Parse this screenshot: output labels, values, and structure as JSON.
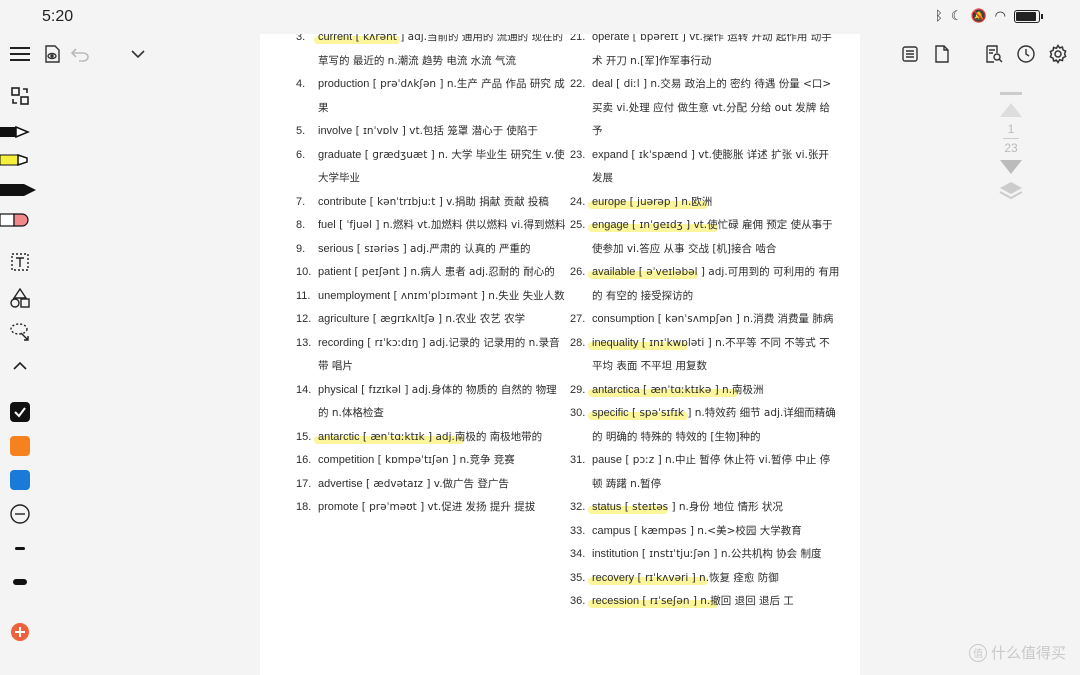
{
  "status": {
    "time": "5:20"
  },
  "palette": {
    "highlight": "#f7ee5a",
    "orange": "#f5811f",
    "blue": "#1a7ad8",
    "red": "#f0603c",
    "black": "#111111"
  },
  "icons": {
    "left_toolbar": [
      "menu-icon",
      "swap-icon",
      "pen-icon",
      "highlighter-icon",
      "marker-icon",
      "eraser-icon",
      "text-box-icon",
      "shapes-icon",
      "lasso-icon",
      "collapse-icon",
      "color-black-swatch",
      "color-orange-swatch",
      "color-blue-swatch",
      "minus-icon",
      "thin-stroke-icon",
      "thick-stroke-icon",
      "add-icon"
    ],
    "top_left": [
      "read-mode-icon",
      "undo-icon",
      "chevron-down-icon"
    ],
    "top_right": [
      "outline-icon",
      "page-icon",
      "search-doc-icon",
      "clock-icon",
      "gear-icon"
    ]
  },
  "pager": {
    "current": "1",
    "total": "23"
  },
  "watermark": {
    "text": "什么值得买",
    "badge": "值"
  },
  "vocab": {
    "left": [
      {
        "num": "3.",
        "word": "current",
        "rest": " [ kʌrənt ] adj.当前的  通用的  流通的  现在的  草写的  最近的 n.潮流  趋势  电流  水流  气流",
        "lines": 3,
        "hl": 86
      },
      {
        "num": "4.",
        "word": "production",
        "rest": "   [ prəˈdʌkʃən ] n.生产  产品  作品   研究  成果",
        "lines": 2
      },
      {
        "num": "5.",
        "word": "involve",
        "rest": "  [ ɪnˈvɒlv ] vt.包括  笼罩  潜心于  使陷于",
        "lines": 1
      },
      {
        "num": "6.",
        "word": "graduate",
        "rest": " [ ɡrædʒuæt ] n.  大学  毕业生  研究生 v.使大学毕业",
        "lines": 2
      },
      {
        "num": "7.",
        "word": "contribute",
        "rest": "    [ kənˈtrɪbjuːt ] v.捐助  捐献  贡献  投稿",
        "lines": 2
      },
      {
        "num": "8.",
        "word": "fuel",
        "rest": " [ ˈfjuəl ]  n.燃料 vt.加燃料  供以燃料 vi.得到燃料",
        "lines": 2
      },
      {
        "num": "9.",
        "word": "serious",
        "rest": "  [ sɪəriəs ]      adj.严肃的  认真的  严重的",
        "lines": 1
      },
      {
        "num": "10.",
        "word": "patient",
        "rest": "  [ peɪʃənt ]      n.病人  患者 adj.忍耐的  耐心的",
        "lines": 2
      },
      {
        "num": "11.",
        "word": "unemployment",
        "rest": "    [ ʌnɪmˈplɔɪmənt ]  n.失业  失业人数",
        "lines": 2
      },
      {
        "num": "12.",
        "word": "agriculture",
        "rest": "    [ æɡrɪkʌltʃə ] n.农业  农艺  农学",
        "lines": 1
      },
      {
        "num": "13.",
        "word": "recording",
        "rest": "     [ rɪˈkɔːdɪŋ ]      adj.记录的  记录用的 n.录音带  唱片",
        "lines": 2
      },
      {
        "num": "14.",
        "word": "physical",
        "rest": " [ fɪzɪkəl ] adj.身体的  物质的  自然的  物理的 n.体格检查",
        "lines": 2
      },
      {
        "num": "15.",
        "word": "antarctic",
        "rest": " [ ænˈtɑːktɪk ]  adj.南极的  南极地带的",
        "lines": 1,
        "hl": 150
      },
      {
        "num": "16.",
        "word": "competition",
        "rest": "  [ kɒmpəˈtɪʃən ]     n.竞争  竞赛",
        "lines": 1
      },
      {
        "num": "17.",
        "word": "advertise",
        "rest": "      [ ædvətaɪz ]   v.做广告  登广告",
        "lines": 1
      },
      {
        "num": "18.",
        "word": "promote",
        "rest": " [ prəˈməʊt ]    vt.促进  发扬  提升  提拔",
        "lines": 1
      }
    ],
    "right": [
      {
        "num": "21.",
        "word": "operate",
        "rest": "  [ ɒpəreɪt ]      vt.操作  运转  开动  起作用  动手术  开刀 n.[军]作军事行动",
        "lines": 2
      },
      {
        "num": "22.",
        "word": "deal",
        "rest": " [ diːl ]      n.交易   政治上的  密约  待遇  份量  <口>买卖 vi.处理  应付  做生意 vt.分配  分给  out 发牌  给予",
        "lines": 3
      },
      {
        "num": "23.",
        "word": "expand",
        "rest": "  [ ɪkˈspænd ]   vt.使膨胀  详述  扩张 vi.张开  发展",
        "lines": 2
      },
      {
        "num": "24.",
        "word": "europe",
        "rest": "  [ juərəp ] n.欧洲",
        "lines": 1,
        "hl": 120
      },
      {
        "num": "25.",
        "word": "engage",
        "rest": "  [ ɪnˈɡeɪdʒ ]   vt.使忙碌  雇佣  预定  使从事于  使参加 vi.答应  从事  交战  [机]接合  啮合",
        "lines": 2,
        "hl": 130
      },
      {
        "num": "26.",
        "word": "available",
        "rest": " [ əˈveɪləbəl ]  adj.可用到的  可利用的  有用的  有空的  接受探访的",
        "lines": 2,
        "hl": 110
      },
      {
        "num": "27.",
        "word": "consumption",
        "rest": " [ kənˈsʌmpʃən ]    n.消费  消费量  肺病",
        "lines": 2
      },
      {
        "num": "28.",
        "word": "inequality",
        "rest": "      [ ɪnɪˈkwɒləti ]  n.不平等  不同  不等式  不平均   表面  不平坦  用复数",
        "lines": 2,
        "hl": 100
      },
      {
        "num": "29.",
        "word": "antarctica",
        "rest": "       [ ænˈtɑːktɪkə ] n.南极洲",
        "lines": 1,
        "hl": 150
      },
      {
        "num": "30.",
        "word": "specific",
        "rest": "  [ spəˈsɪfɪk ]     n.特效药  细节 adj.详细而精确的  明确的  特殊的  特效的  [生物]种的",
        "lines": 2,
        "hl": 100
      },
      {
        "num": "31.",
        "word": "pause",
        "rest": "  [ pɔːz ]       n.中止  暂停  休止符 vi.暂停  中止  停顿  踌躇 n.暂停",
        "lines": 2
      },
      {
        "num": "32.",
        "word": "status",
        "rest": "  [ steɪtəs ]      n.身份  地位  情形  状况",
        "lines": 1,
        "hl": 80
      },
      {
        "num": "33.",
        "word": "campus",
        "rest": "  [ kæmpəs ]     n.<美>校园  大学教育",
        "lines": 1
      },
      {
        "num": "34.",
        "word": "institution",
        "rest": "      [ ɪnstɪˈtjuːʃən ] n.公共机构  协会  制度",
        "lines": 1
      },
      {
        "num": "35.",
        "word": "recovery",
        "rest": " [ rɪˈkʌvəri ]      n.恢复  痊愈  防御",
        "lines": 1,
        "hl": 120
      },
      {
        "num": "36.",
        "word": "recession",
        "rest": "       [ rɪˈseʃən ]      n.撤回  退回  退后  工",
        "lines": 1,
        "hl": 130
      }
    ]
  }
}
